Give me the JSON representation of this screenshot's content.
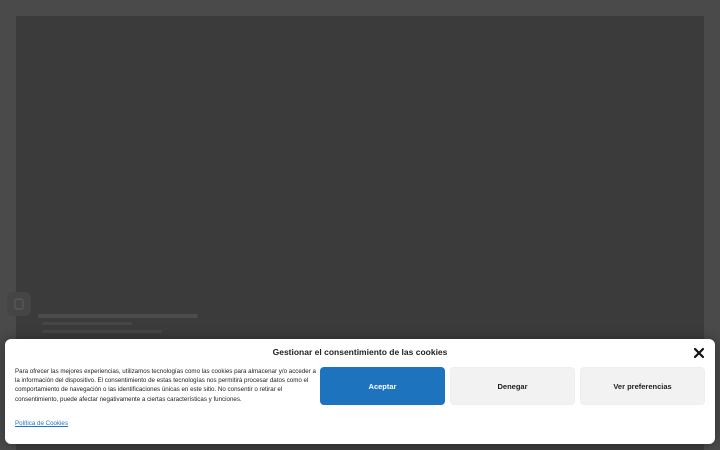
{
  "cookie_banner": {
    "title": "Gestionar el consentimiento de las cookies",
    "message": "Para ofrecer las mejores experiencias, utilizamos tecnologías como las cookies para almacenar y/o acceder a la información del dispositivo. El consentimiento de estas tecnologías nos permitirá procesar datos como el comportamiento de navegación o las identificaciones únicas en este sitio. No consentir o retirar el consentimiento, puede afectar negativamente a ciertas características y funciones.",
    "accept_label": "Aceptar",
    "deny_label": "Denegar",
    "preferences_label": "Ver preferencias",
    "policy_link": "Política de Cookies",
    "close_icon": "close-icon"
  },
  "colors": {
    "accent": "#1e73be",
    "overlay": "#4a4a4a",
    "panel": "#3b3b3b"
  }
}
